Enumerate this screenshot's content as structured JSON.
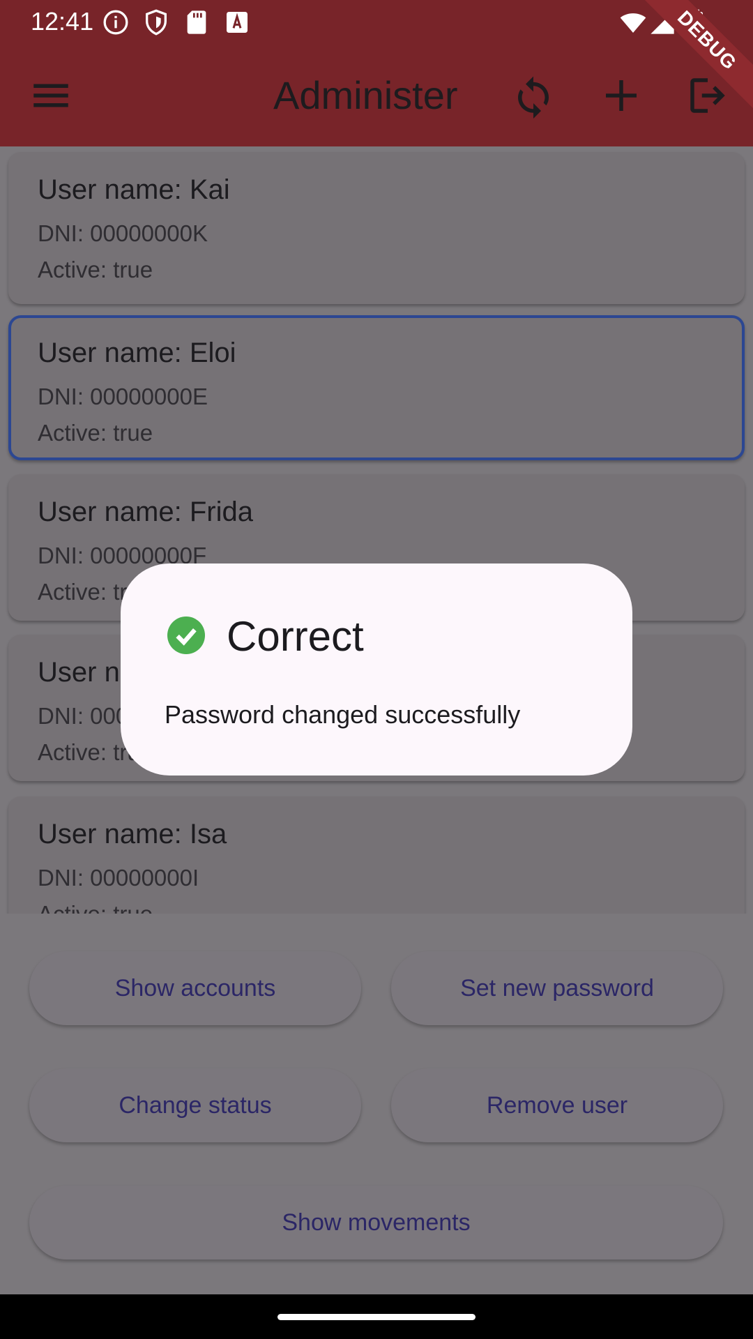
{
  "status_bar": {
    "time": "12:41",
    "left_icons": [
      "info-icon",
      "shield-icon",
      "sd-card-icon",
      "font-download-icon"
    ],
    "right_icons": [
      "wifi-icon",
      "signal-icon",
      "battery-icon"
    ]
  },
  "app_bar": {
    "title": "Administer",
    "actions": [
      "refresh-icon",
      "add-icon",
      "logout-icon"
    ],
    "color": "#782429"
  },
  "debug_banner": "DEBUG",
  "users": [
    {
      "name": "User name: Kai",
      "dni": "DNI: 00000000K",
      "active": "Active: true",
      "selected": false
    },
    {
      "name": "User name: Eloi",
      "dni": "DNI: 00000000E",
      "active": "Active: true",
      "selected": true
    },
    {
      "name": "User name: Frida",
      "dni": "DNI: 00000000F",
      "active": "Active: true",
      "selected": false
    },
    {
      "name": "User name: Gina",
      "dni": "DNI: 00000000G",
      "active": "Active: true",
      "selected": false
    },
    {
      "name": "User name: Isa",
      "dni": "DNI: 00000000I",
      "active": "Active: true",
      "selected": false
    }
  ],
  "buttons": {
    "show_accounts": "Show accounts",
    "set_new_password": "Set new password",
    "change_status": "Change status",
    "remove_user": "Remove user",
    "show_movements": "Show movements"
  },
  "dialog": {
    "title": "Correct",
    "message": "Password changed successfully",
    "icon": "check-circle-icon",
    "icon_color": "#4caf50"
  }
}
